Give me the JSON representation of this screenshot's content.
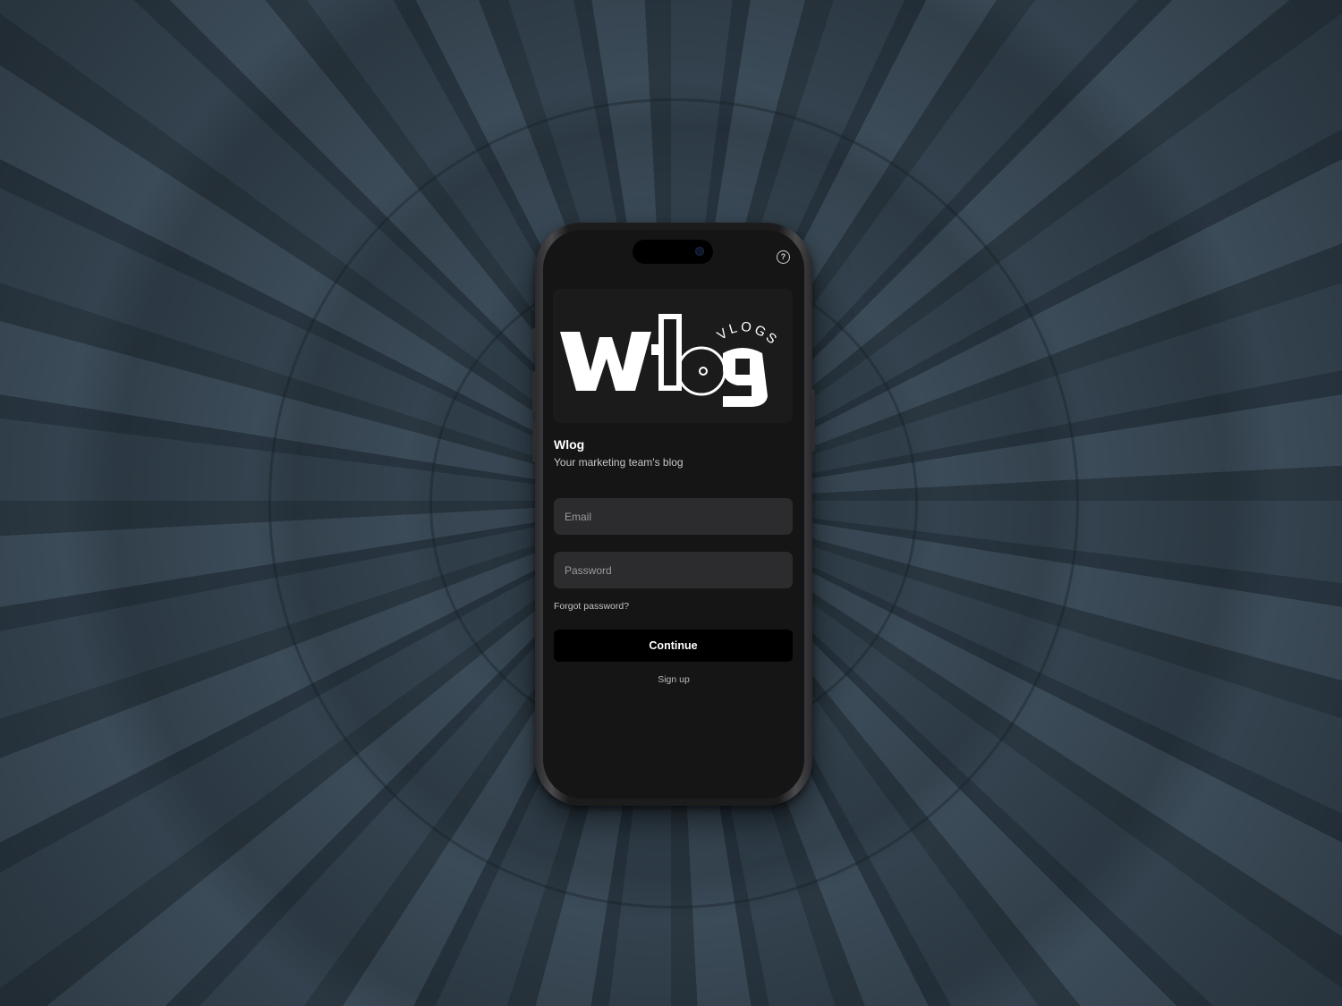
{
  "app": {
    "title": "Wlog",
    "subtitle": "Your marketing team's blog"
  },
  "logo": {
    "wordmark": "Wlog",
    "arc_text": "VLOGS"
  },
  "form": {
    "email_placeholder": "Email",
    "email_value": "",
    "password_placeholder": "Password",
    "password_value": "",
    "forgot_label": "Forgot password?",
    "continue_label": "Continue",
    "signup_label": "Sign up"
  },
  "icons": {
    "help": "help-circle-icon"
  },
  "colors": {
    "screen_bg": "#151516",
    "field_bg": "#2c2c2e",
    "button_bg": "#000000",
    "text_primary": "#ffffff",
    "background_fabric": "#2e3c47"
  }
}
